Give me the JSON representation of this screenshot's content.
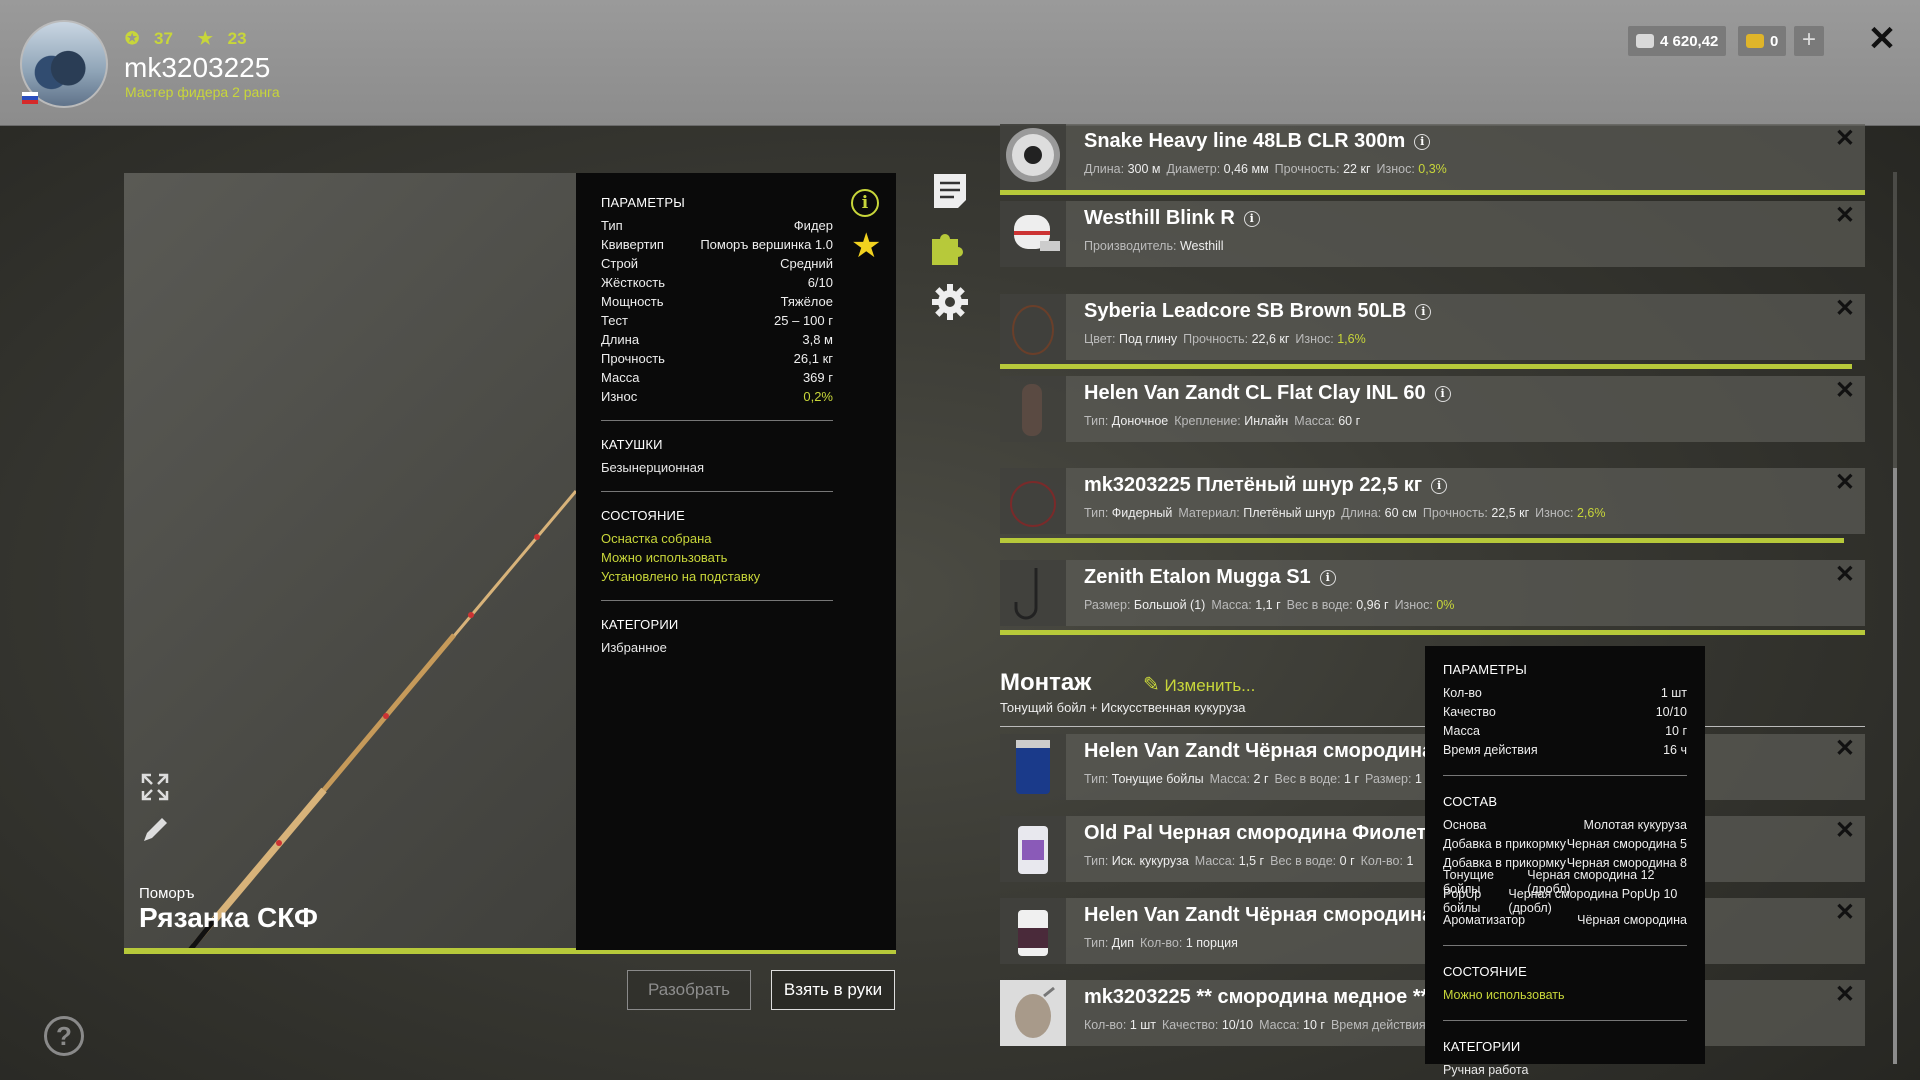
{
  "player": {
    "level": "37",
    "stars": "23",
    "username": "mk3203225",
    "rank": "Мастер фидера 2 ранга"
  },
  "currency": {
    "silver": "4 620,42",
    "gold": "0",
    "plus": "+"
  },
  "close_label": "✕",
  "rod": {
    "brand": "Поморъ",
    "name": "Рязанка СКФ"
  },
  "params": {
    "header": "ПАРАМЕТРЫ",
    "rows": [
      {
        "k": "Тип",
        "v": "Фидер"
      },
      {
        "k": "Квивертип",
        "v": "Поморъ вершинка 1.0"
      },
      {
        "k": "Строй",
        "v": "Средний"
      },
      {
        "k": "Жёсткость",
        "v": "6/10"
      },
      {
        "k": "Мощность",
        "v": "Тяжёлое"
      },
      {
        "k": "Тест",
        "v": "25 – 100 г"
      },
      {
        "k": "Длина",
        "v": "3,8 м"
      },
      {
        "k": "Прочность",
        "v": "26,1 кг"
      },
      {
        "k": "Масса",
        "v": "369 г"
      },
      {
        "k": "Износ",
        "v": "0,2%"
      }
    ],
    "reels_header": "КАТУШКИ",
    "reels": "Безынерционная",
    "state_header": "СОСТОЯНИЕ",
    "states": [
      "Оснастка собрана",
      "Можно использовать",
      "Установлено на подставку"
    ],
    "cat_header": "КАТЕГОРИИ",
    "category": "Избранное"
  },
  "buttons": {
    "disassemble": "Разобрать",
    "take": "Взять в руки"
  },
  "help": "?",
  "items": [
    {
      "title": "Snake Heavy line 48LB CLR 300m",
      "sub": [
        [
          "Длина:",
          "300 м"
        ],
        [
          "Диаметр:",
          "0,46 мм"
        ],
        [
          "Прочность:",
          "22 кг"
        ],
        [
          "Износ:",
          "0,3%"
        ]
      ]
    },
    {
      "title": "Westhill Blink R",
      "sub": [
        [
          "Производитель:",
          "Westhill"
        ]
      ]
    },
    {
      "title": "Syberia Leadcore SB Brown 50LB",
      "sub": [
        [
          "Цвет:",
          "Под глину"
        ],
        [
          "Прочность:",
          "22,6 кг"
        ],
        [
          "Износ:",
          "1,6%"
        ]
      ]
    },
    {
      "title": "Helen Van Zandt CL Flat Clay INL 60",
      "sub": [
        [
          "Тип:",
          "Доночное"
        ],
        [
          "Крепление:",
          "Инлайн"
        ],
        [
          "Масса:",
          "60 г"
        ]
      ]
    },
    {
      "title": "mk3203225 Плетёный шнур 22,5 кг",
      "sub": [
        [
          "Тип:",
          "Фидерный"
        ],
        [
          "Материал:",
          "Плетёный шнур"
        ],
        [
          "Длина:",
          "60 см"
        ],
        [
          "Прочность:",
          "22,5 кг"
        ],
        [
          "Износ:",
          "2,6%"
        ]
      ]
    },
    {
      "title": "Zenith Etalon Mugga S1",
      "sub": [
        [
          "Размер:",
          "Большой (1)"
        ],
        [
          "Масса:",
          "1,1 г"
        ],
        [
          "Вес в воде:",
          "0,96 г"
        ],
        [
          "Износ:",
          "0%"
        ]
      ]
    }
  ],
  "montage": {
    "title": "Монтаж",
    "edit": "Изменить...",
    "subtitle": "Тонущий бойл + Искусственная кукуруза"
  },
  "baits": [
    {
      "title": "Helen Van Zandt Чёрная смородина 12",
      "sub": [
        [
          "Тип:",
          "Тонущие бойлы"
        ],
        [
          "Масса:",
          "2 г"
        ],
        [
          "Вес в воде:",
          "1 г"
        ],
        [
          "Размер:",
          "1"
        ]
      ]
    },
    {
      "title": "Old Pal Черная смородина Фиолетовы",
      "sub": [
        [
          "Тип:",
          "Иск. кукуруза"
        ],
        [
          "Масса:",
          "1,5 г"
        ],
        [
          "Вес в воде:",
          "0 г"
        ],
        [
          "Кол-во:",
          "1"
        ]
      ]
    },
    {
      "title": "Helen Van Zandt Чёрная смородина",
      "sub": [
        [
          "Тип:",
          "Дип"
        ],
        [
          "Кол-во:",
          "1 порция"
        ]
      ]
    },
    {
      "title": "mk3203225 ** смородина медное **",
      "sub": [
        [
          "Кол-во:",
          "1 шт"
        ],
        [
          "Качество:",
          "10/10"
        ],
        [
          "Масса:",
          "10 г"
        ],
        [
          "Время действия",
          ""
        ]
      ]
    }
  ],
  "tooltip": {
    "params_header": "ПАРАМЕТРЫ",
    "params": [
      {
        "k": "Кол-во",
        "v": "1 шт"
      },
      {
        "k": "Качество",
        "v": "10/10"
      },
      {
        "k": "Масса",
        "v": "10 г"
      },
      {
        "k": "Время действия",
        "v": "16 ч"
      }
    ],
    "composition_header": "СОСТАВ",
    "composition": [
      {
        "k": "Основа",
        "v": "Молотая кукуруза"
      },
      {
        "k": "Добавка в прикормку",
        "v": "Черная смородина 5"
      },
      {
        "k": "Добавка в прикормку",
        "v": "Черная смородина 8"
      },
      {
        "k": "Тонущие бойлы",
        "v": "Черная смородина 12 (дробл)"
      },
      {
        "k": "PopUp бойлы",
        "v": "Черная смородина PopUp 10 (дробл)"
      },
      {
        "k": "Ароматизатор",
        "v": "Чёрная смородина"
      }
    ],
    "state_header": "СОСТОЯНИЕ",
    "state": "Можно использовать",
    "cat_header": "КАТЕГОРИИ",
    "category": "Ручная работа"
  },
  "colors": {
    "accent": "#c8d63a",
    "star": "#f2d21f",
    "panel": "#0a0a0a"
  },
  "icons": [
    "level-icon",
    "star-small-icon",
    "silver-coin-icon",
    "gold-coin-icon",
    "close-icon",
    "info-icon",
    "star-icon",
    "notes-icon",
    "puzzle-icon",
    "gear-icon",
    "expand-icon",
    "edit-icon",
    "help-icon"
  ]
}
